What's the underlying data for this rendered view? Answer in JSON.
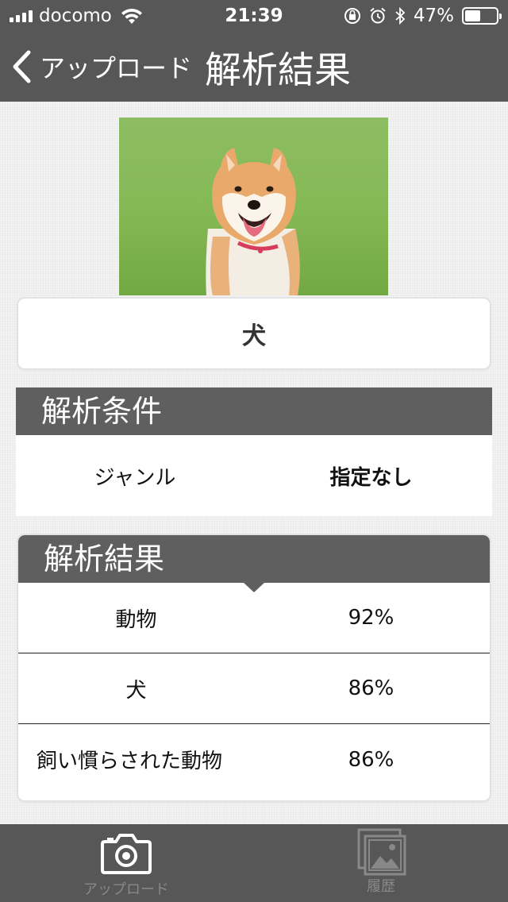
{
  "status": {
    "carrier": "docomo",
    "time": "21:39",
    "battery": "47%"
  },
  "nav": {
    "back_label": "アップロード",
    "title": "解析結果"
  },
  "top_result": "犬",
  "conditions": {
    "title": "解析条件",
    "rows": [
      {
        "label": "ジャンル",
        "value": "指定なし"
      }
    ]
  },
  "results": {
    "title": "解析結果",
    "rows": [
      {
        "label": "動物",
        "value": "92%"
      },
      {
        "label": "犬",
        "value": "86%"
      },
      {
        "label": "飼い慣らされた動物",
        "value": "86%"
      }
    ]
  },
  "tabs": [
    {
      "label": "アップロード",
      "icon": "camera-icon"
    },
    {
      "label": "履歴",
      "icon": "photo-gallery-icon"
    }
  ],
  "colors": {
    "bar": "#575757",
    "section_header": "#5f5f5f",
    "background": "#efefef"
  }
}
